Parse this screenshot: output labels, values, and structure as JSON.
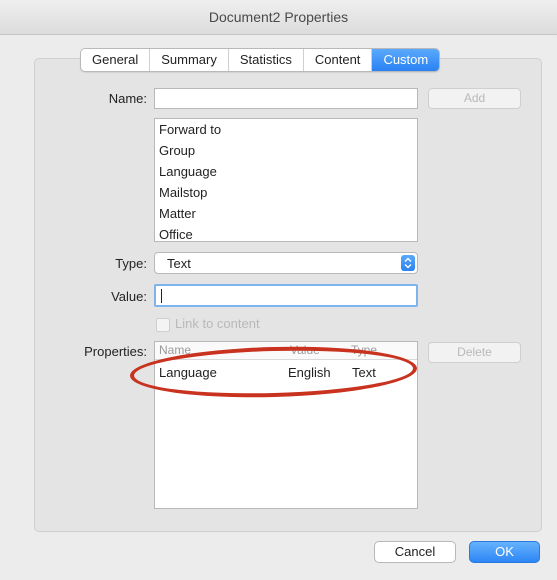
{
  "window": {
    "title": "Document2 Properties"
  },
  "tabs": [
    "General",
    "Summary",
    "Statistics",
    "Content",
    "Custom"
  ],
  "active_tab": "Custom",
  "form": {
    "name_label": "Name:",
    "name_value": "",
    "add_label": "Add",
    "name_options": [
      "Forward to",
      "Group",
      "Language",
      "Mailstop",
      "Matter",
      "Office"
    ],
    "type_label": "Type:",
    "type_value": "Text",
    "value_label": "Value:",
    "value_value": "",
    "link_label": "Link to content",
    "properties_label": "Properties:",
    "delete_label": "Delete",
    "properties_columns": [
      "Name",
      "Value",
      "Type"
    ],
    "properties_rows": [
      {
        "name": "Language",
        "value": "English",
        "type": "Text"
      }
    ]
  },
  "buttons": {
    "cancel": "Cancel",
    "ok": "OK"
  },
  "colors": {
    "accent": "#2a82f3",
    "highlight": "#c8321f"
  }
}
